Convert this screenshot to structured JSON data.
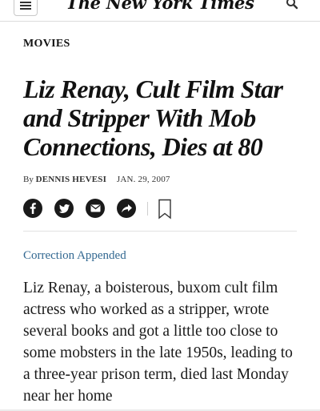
{
  "header": {
    "masthead": "The New York Times",
    "menu_icon": "hamburger-menu-icon",
    "search_icon": "search-icon"
  },
  "article": {
    "section": "MOVIES",
    "headline": "Liz Renay, Cult Film Star and Stripper With Mob Connections, Dies at 80",
    "byline_prefix": "By",
    "author": "DENNIS HEVESI",
    "date": "JAN. 29, 2007",
    "correction_link": "Correction Appended",
    "body": "Liz Renay, a boisterous, buxom cult film actress who worked as a stripper, wrote several books and got a little too close to some mobsters in the late 1950s, leading to a three-year prison term, died last Monday near her home"
  },
  "share": {
    "icons": [
      "facebook-icon",
      "twitter-icon",
      "email-icon",
      "share-icon",
      "bookmark-icon"
    ]
  },
  "colors": {
    "link": "#326891",
    "text": "#121212",
    "icon_bg": "#1a1a1a"
  }
}
